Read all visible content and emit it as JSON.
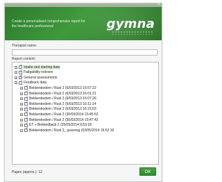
{
  "dialog": {
    "close_glyph": "×",
    "header_text": "Create a personalised comprehensive report for the healthcare professional",
    "logo": "gymna"
  },
  "form": {
    "therapist_label": "Therapist name:",
    "therapist_value": "",
    "report_content_label": "Report content:"
  },
  "tree": {
    "items": [
      {
        "label": "Intake and starting data",
        "level": 0,
        "checked": true,
        "highlight": true
      },
      {
        "label": "Fatigability indexes",
        "level": 0,
        "checked": true,
        "highlight": false
      },
      {
        "label": "General assessments",
        "level": 0,
        "checked": true,
        "highlight": false
      },
      {
        "label": "Feedback data",
        "level": 0,
        "checked": true,
        "highlight": false
      },
      {
        "label": "Bekkenbodem / Rust 2 (6/03/2013 15:57:22",
        "level": 1,
        "checked": true,
        "highlight": false
      },
      {
        "label": "Bekkenbodem / Rust 2 (6/03/2013 16:01:21",
        "level": 1,
        "checked": true,
        "highlight": false
      },
      {
        "label": "Bekkenbodem / Rust 2 (6/03/2013 16:07:26",
        "level": 1,
        "checked": true,
        "highlight": false
      },
      {
        "label": "Bekkenbodem / Rust 2 (6/03/2013 16:11:14",
        "level": 1,
        "checked": true,
        "highlight": false
      },
      {
        "label": "Bekkenbodem / Rust 2 (6/03/2013 16:21:03",
        "level": 1,
        "checked": true,
        "highlight": false
      },
      {
        "label": "Bekkenbodem / Rust 2 (30/03/2014 15:45:53",
        "level": 1,
        "checked": true,
        "highlight": false
      },
      {
        "label": "Bekkenbodem / Rust 2 (30/03/2014 15:47:42",
        "level": 1,
        "checked": true,
        "highlight": false
      },
      {
        "label": "ET + Biofeedback 2 (25/03/2014 9:53:18",
        "level": 1,
        "checked": true,
        "highlight": false
      },
      {
        "label": "Bekkenbodem / Rust 2_ gvanvsg (02/05/2014 15:52:16",
        "level": 1,
        "checked": true,
        "highlight": false
      }
    ]
  },
  "footer": {
    "pages_label": "Pages (approx.): 12",
    "ok_label": "OK"
  },
  "colors": {
    "brand_green": "#3f9a3b",
    "check_blue": "#2f55c6"
  }
}
